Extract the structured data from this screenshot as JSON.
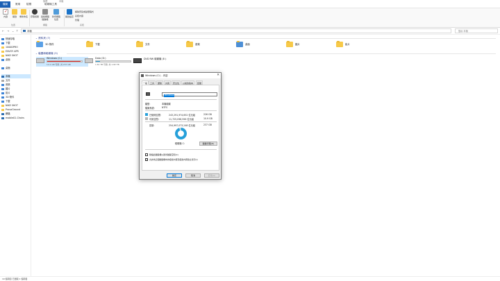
{
  "ribbon_tabs": {
    "file": "檔案",
    "home": "常用",
    "share": "共用",
    "view": "檢視",
    "manage": "管理",
    "drive_tools": "磁碟機工具",
    "context_label": "管理",
    "context_label2": "本機"
  },
  "ribbon": {
    "pin": "釘選到快速存取",
    "copy": "複製",
    "paste": "貼上",
    "properties": "內容",
    "open": "開啟",
    "rename": "重新命名",
    "access_media": "存取媒體",
    "map_drive": "連線網路磁碟機",
    "add_location": "新增網路位置",
    "open_settings": "開啟設定",
    "uninstall": "解除安裝或變更程式",
    "system_props": "系統內容",
    "manage": "管理",
    "group_clipboard": "位置",
    "group_network": "網路",
    "group_system": "系統"
  },
  "address": {
    "path": "本機",
    "search_placeholder": "搜尋 本機"
  },
  "sidebar": {
    "items": [
      {
        "label": "快速存取"
      },
      {
        "label": "下載"
      },
      {
        "label": "1000DPRO"
      },
      {
        "label": "ENVOY APR"
      },
      {
        "label": "NIKE SHOT"
      },
      {
        "label": "桌面"
      },
      {
        "label": "桌面"
      },
      {
        "label": "本機"
      },
      {
        "label": "文件"
      },
      {
        "label": "音樂"
      },
      {
        "label": "圖片"
      },
      {
        "label": "影片"
      },
      {
        "label": "3D 物件"
      },
      {
        "label": "下載"
      },
      {
        "label": "NIKE SHOT"
      },
      {
        "label": "ProvaGround"
      },
      {
        "label": "網路"
      },
      {
        "label": "mobile01-Chairs"
      }
    ]
  },
  "content": {
    "folders_header": "資料夾 (7)",
    "folders": [
      {
        "name": "3D 物件"
      },
      {
        "name": "下載"
      },
      {
        "name": "文件"
      },
      {
        "name": "音樂"
      },
      {
        "name": "桌面"
      },
      {
        "name": "圖片"
      },
      {
        "name": "影片"
      }
    ],
    "drives_header": "裝置和磁碟機 (3)",
    "drives": [
      {
        "name": "Windows (C:)",
        "free": "14.1 GB 可用, 共 237 GB",
        "used_fraction": 0.95,
        "color": "#da2626"
      },
      {
        "name": "Data (D:)",
        "free": "1.61 TB 可用, 共 1.82 TB",
        "used_fraction": 0.12,
        "color": "#26a0da"
      },
      {
        "name": "DVD RW 磁碟機 (E:)"
      }
    ]
  },
  "statusbar": {
    "text": "10 個項目  已選取 1 個項目"
  },
  "dialog": {
    "title": "Windows (C:) - 內容",
    "close": "✕",
    "tabs": [
      "一般",
      "工具",
      "硬體",
      "共用",
      "安全性",
      "以前的版本",
      "配額"
    ],
    "name_value": "Windows",
    "type_label": "類型:",
    "type_value": "本機磁碟",
    "fs_label": "檔案系統:",
    "fs_value": "NTFS",
    "used_label": "已使用空間:",
    "used_bytes": "243,291,974,652 位元組",
    "used_gb": "226 GB",
    "free_label": "可用空間:",
    "free_bytes": "11,725,098,596 位元組",
    "free_gb": "10.9 GB",
    "capacity_label": "容量:",
    "capacity_bytes": "254,997,073,248 位元組",
    "capacity_gb": "237 GB",
    "used_color": "#26a0da",
    "free_color": "#b4b4b4",
    "drive_label": "磁碟機 C:",
    "cleanup_button": "磁碟清理(D)",
    "compress_checkbox": "壓縮此磁碟機以節省磁碟空間(C)",
    "index_checkbox": "允許為這個磁碟機中的檔案內容及檔案內容建立索引(I)",
    "compress_checked": false,
    "index_checked": true,
    "ok": "確定",
    "cancel": "取消",
    "apply": "套用(A)"
  }
}
